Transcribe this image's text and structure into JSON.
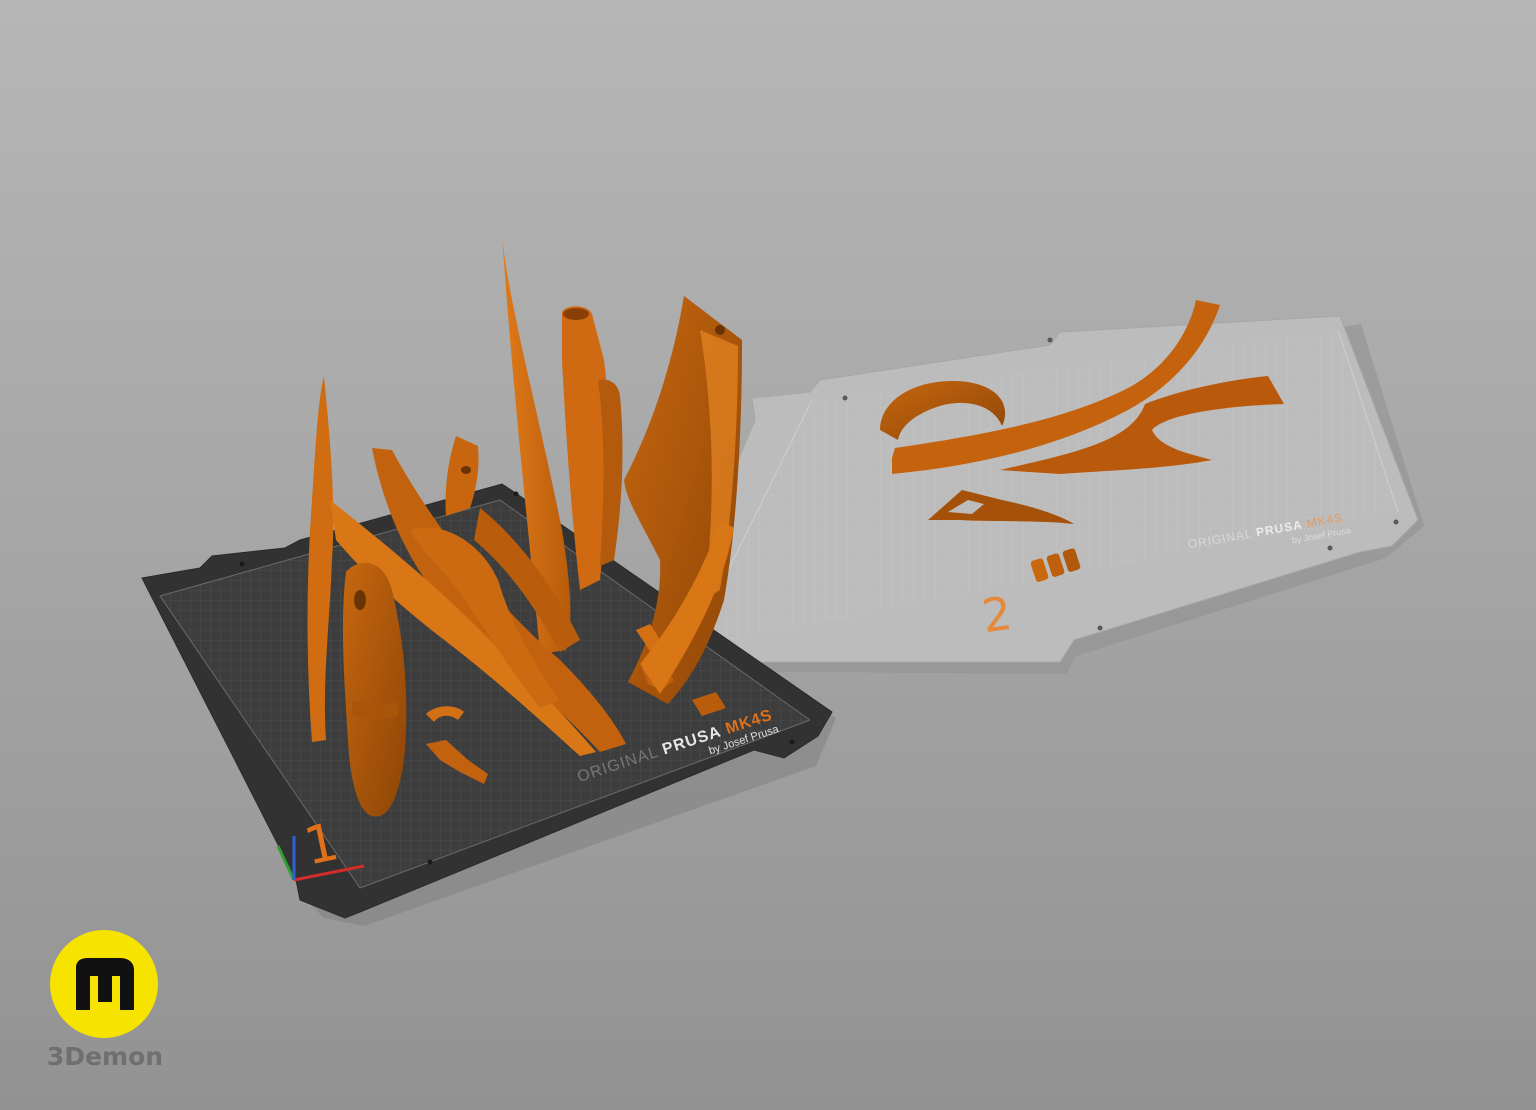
{
  "scene": {
    "bed1": {
      "number": "1",
      "brand_left": "ORIGINAL",
      "brand_mid": "PRUSA",
      "brand_right": "MK4S",
      "brand_sub": "by Josef Prusa"
    },
    "bed2": {
      "number": "2",
      "brand_left": "ORIGINAL",
      "brand_mid": "PRUSA",
      "brand_right": "MK4S",
      "brand_sub": "by Josef Prusa"
    }
  },
  "watermark": {
    "label": "3Demon",
    "icon": "3demon-logo-icon"
  },
  "colors": {
    "background": "#a9a9a9",
    "model_orange": "#d46a0c",
    "model_dark": "#9a4a07",
    "bed_active": "#3a3a3a",
    "bed_inactive": "#b9b9b9",
    "accent": "#f6e400"
  }
}
